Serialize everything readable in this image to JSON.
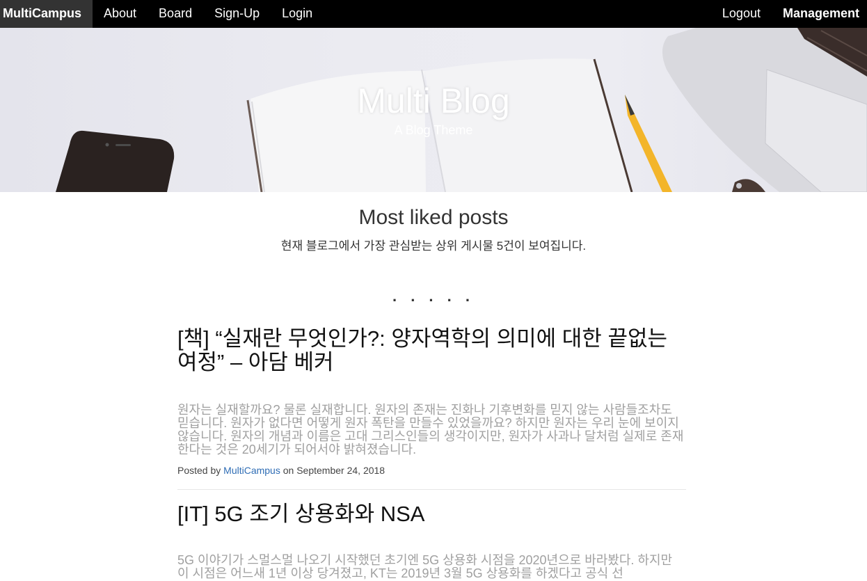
{
  "nav": {
    "brand": "MultiCampus",
    "left_items": [
      "About",
      "Board",
      "Sign-Up",
      "Login"
    ],
    "right_items": [
      "Logout",
      "Management"
    ]
  },
  "hero": {
    "title": "Multi Blog",
    "subtitle": "A Blog Theme"
  },
  "section": {
    "title": "Most liked posts",
    "description": "현재 블로그에서 가장 관심받는 상위 게시물 5건이 보여집니다.",
    "separator": ". . . . ."
  },
  "posts": [
    {
      "title": "[책] “실재란 무엇인가?: 양자역학의 의미에 대한 끝없는 여정” – 아담 베커",
      "excerpt": "원자는 실재할까요? 물론 실재합니다. 원자의 존재는 진화나 기후변화를 믿지 않는 사람들조차도 믿습니다. 원자가 없다면 어떻게 원자 폭탄을 만들수 있었을까요? 하지만 원자는 우리 눈에 보이지 않습니다. 원자의 개념과 이름은 고대 그리스인들의 생각이지만, 원자가 사과나 달처럼 실제로 존재한다는 것은 20세기가 되어서야 밝혀졌습니다.",
      "posted_by_prefix": "Posted by",
      "author": "MultiCampus",
      "date_prefix": "on",
      "date": "September 24, 2018"
    },
    {
      "title": "[IT] 5G 조기 상용화와 NSA",
      "excerpt": "5G 이야기가 스멀스멀 나오기 시작했던 초기엔 5G 상용화 시점을 2020년으로 바라봤다. 하지만 이 시점은 어느새 1년 이상 당겨졌고, KT는 2019년 3월 5G 상용화를 하겠다고 공식 선"
    }
  ]
}
